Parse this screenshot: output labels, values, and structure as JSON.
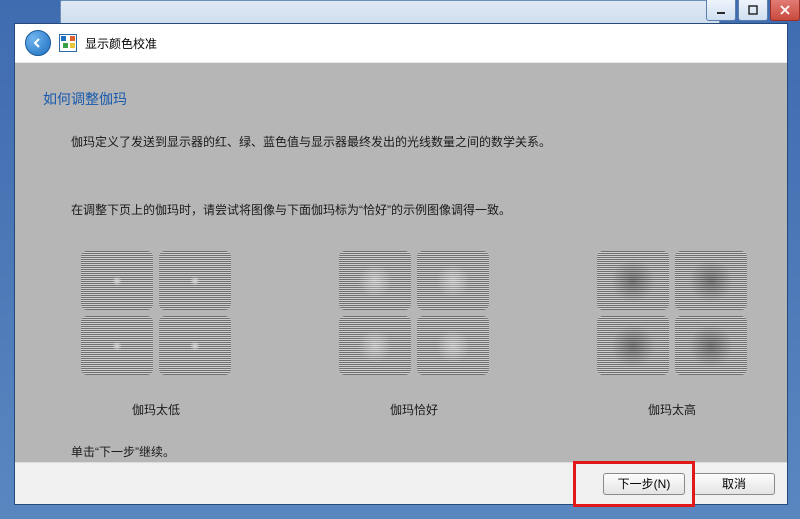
{
  "titlebar": {
    "minimize_name": "minimize",
    "maximize_name": "maximize",
    "close_name": "close"
  },
  "header": {
    "back_name": "back",
    "app_title": "显示颜色校准"
  },
  "content": {
    "heading": "如何调整伽玛",
    "para1": "伽玛定义了发送到显示器的红、绿、蓝色值与显示器最终发出的光线数量之间的数学关系。",
    "para2": "在调整下页上的伽玛时，请尝试将图像与下面伽玛标为“恰好”的示例图像调得一致。",
    "examples": {
      "low": "伽玛太低",
      "good": "伽玛恰好",
      "high": "伽玛太高"
    },
    "para3": "单击“下一步”继续。"
  },
  "footer": {
    "next": "下一步(N)",
    "cancel": "取消"
  }
}
